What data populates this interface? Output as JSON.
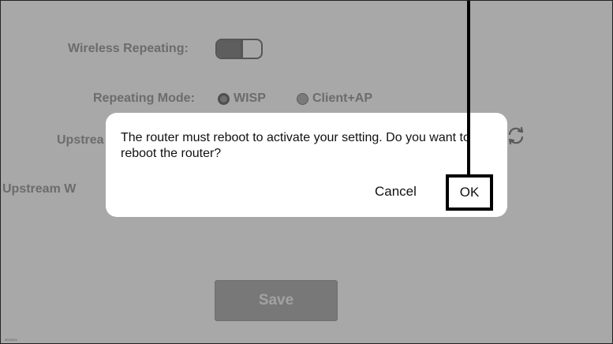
{
  "settings": {
    "wireless_repeating_label": "Wireless Repeating:",
    "wireless_repeating_state": "on",
    "repeating_mode_label": "Repeating Mode:",
    "repeating_mode_options": [
      "WISP",
      "Client+AP"
    ],
    "repeating_mode_selected": "WISP",
    "upstream_label_visible": "Upstrea",
    "upstream_w_label_visible": "Upstream W",
    "save_label": "Save"
  },
  "dialog": {
    "message": "The router must reboot to activate your setting.  Do you want to reboot the router?",
    "cancel_label": "Cancel",
    "ok_label": "OK"
  },
  "icons": {
    "refresh": "refresh-icon"
  },
  "colors": {
    "overlay_bg": "#a8a8a8",
    "dialog_bg": "#ffffff",
    "highlight": "#000000"
  },
  "figure_code": "WC0014"
}
